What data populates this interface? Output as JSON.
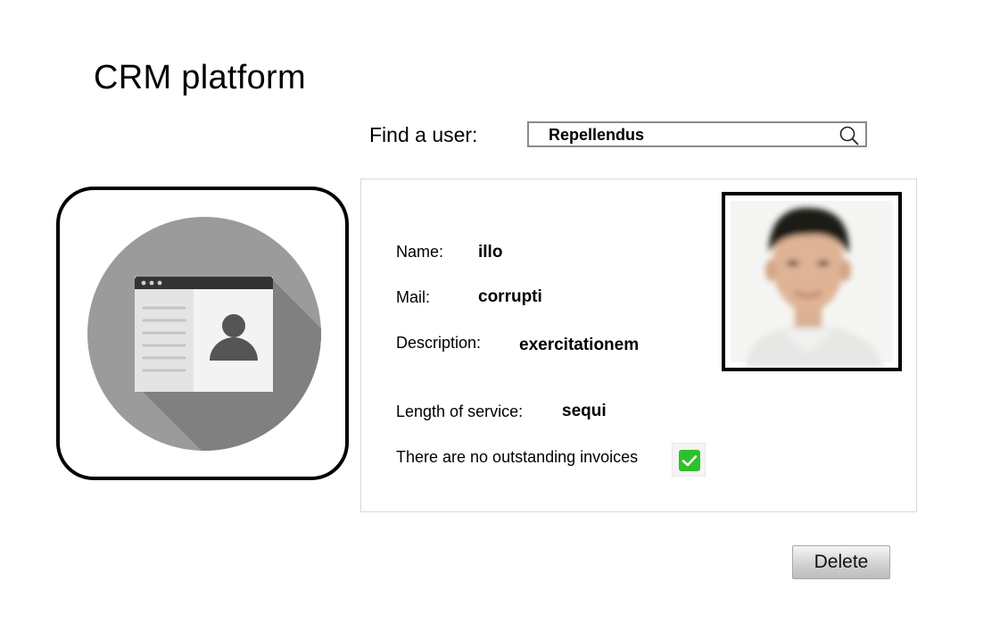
{
  "app": {
    "title": "CRM platform"
  },
  "search": {
    "label": "Find a user:",
    "value": "Repellendus",
    "icon": "search-icon"
  },
  "profile_icon": {
    "icon": "contact-card-icon",
    "colors": {
      "circle": "#9b9b9b",
      "shadow": "#7f7f7f",
      "card": "#eeeeee",
      "bar": "#333333"
    }
  },
  "user": {
    "name_label": "Name:",
    "name": "illo",
    "mail_label": "Mail:",
    "mail": "corrupti",
    "description_label": "Description:",
    "description": "exercitationem",
    "service_label": "Length of service:",
    "service": "sequi",
    "invoices_label": "There are no outstanding invoices",
    "invoices_checked": true
  },
  "colors": {
    "checkbox": "#2ec02a"
  },
  "actions": {
    "delete_label": "Delete"
  }
}
